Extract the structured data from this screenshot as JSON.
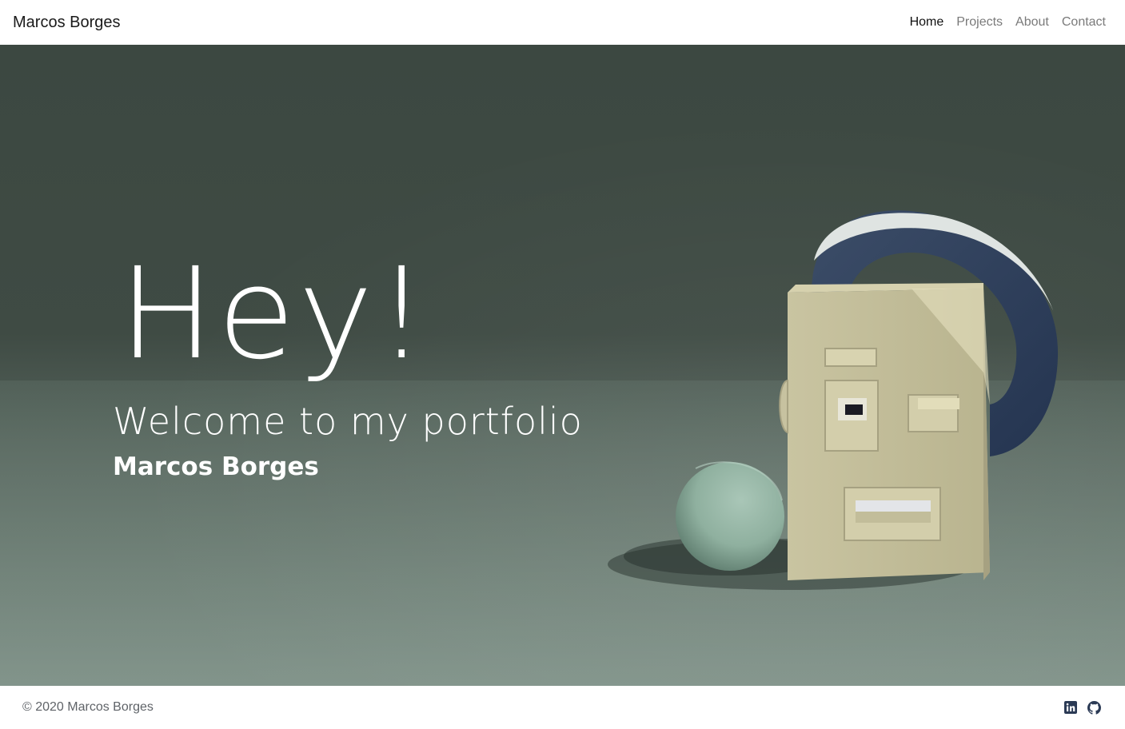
{
  "navbar": {
    "brand": "Marcos Borges",
    "links": [
      {
        "label": "Home",
        "active": true
      },
      {
        "label": "Projects",
        "active": false
      },
      {
        "label": "About",
        "active": false
      },
      {
        "label": "Contact",
        "active": false
      }
    ]
  },
  "hero": {
    "title": "Hey!",
    "subtitle": "Welcome to my portfolio",
    "name": "Marcos Borges"
  },
  "footer": {
    "copyright": "© 2020 Marcos Borges",
    "social_icons": [
      "linkedin-icon",
      "github-icon"
    ]
  },
  "colors": {
    "hero_bg": "#3f4b44",
    "hero_text": "#ffffff",
    "nav_active": "#111111",
    "nav_inactive": "#7a7a7a",
    "footer_text": "#5f6368"
  }
}
